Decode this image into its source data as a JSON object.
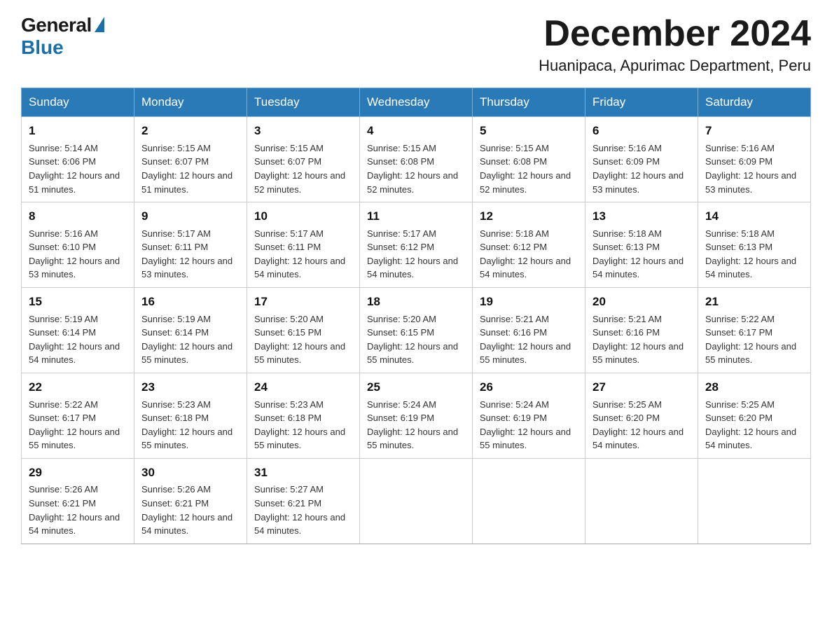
{
  "header": {
    "logo_general": "General",
    "logo_blue": "Blue",
    "month_title": "December 2024",
    "location": "Huanipaca, Apurimac Department, Peru"
  },
  "weekdays": [
    "Sunday",
    "Monday",
    "Tuesday",
    "Wednesday",
    "Thursday",
    "Friday",
    "Saturday"
  ],
  "weeks": [
    [
      {
        "day": "1",
        "sunrise": "5:14 AM",
        "sunset": "6:06 PM",
        "daylight": "12 hours and 51 minutes."
      },
      {
        "day": "2",
        "sunrise": "5:15 AM",
        "sunset": "6:07 PM",
        "daylight": "12 hours and 51 minutes."
      },
      {
        "day": "3",
        "sunrise": "5:15 AM",
        "sunset": "6:07 PM",
        "daylight": "12 hours and 52 minutes."
      },
      {
        "day": "4",
        "sunrise": "5:15 AM",
        "sunset": "6:08 PM",
        "daylight": "12 hours and 52 minutes."
      },
      {
        "day": "5",
        "sunrise": "5:15 AM",
        "sunset": "6:08 PM",
        "daylight": "12 hours and 52 minutes."
      },
      {
        "day": "6",
        "sunrise": "5:16 AM",
        "sunset": "6:09 PM",
        "daylight": "12 hours and 53 minutes."
      },
      {
        "day": "7",
        "sunrise": "5:16 AM",
        "sunset": "6:09 PM",
        "daylight": "12 hours and 53 minutes."
      }
    ],
    [
      {
        "day": "8",
        "sunrise": "5:16 AM",
        "sunset": "6:10 PM",
        "daylight": "12 hours and 53 minutes."
      },
      {
        "day": "9",
        "sunrise": "5:17 AM",
        "sunset": "6:11 PM",
        "daylight": "12 hours and 53 minutes."
      },
      {
        "day": "10",
        "sunrise": "5:17 AM",
        "sunset": "6:11 PM",
        "daylight": "12 hours and 54 minutes."
      },
      {
        "day": "11",
        "sunrise": "5:17 AM",
        "sunset": "6:12 PM",
        "daylight": "12 hours and 54 minutes."
      },
      {
        "day": "12",
        "sunrise": "5:18 AM",
        "sunset": "6:12 PM",
        "daylight": "12 hours and 54 minutes."
      },
      {
        "day": "13",
        "sunrise": "5:18 AM",
        "sunset": "6:13 PM",
        "daylight": "12 hours and 54 minutes."
      },
      {
        "day": "14",
        "sunrise": "5:18 AM",
        "sunset": "6:13 PM",
        "daylight": "12 hours and 54 minutes."
      }
    ],
    [
      {
        "day": "15",
        "sunrise": "5:19 AM",
        "sunset": "6:14 PM",
        "daylight": "12 hours and 54 minutes."
      },
      {
        "day": "16",
        "sunrise": "5:19 AM",
        "sunset": "6:14 PM",
        "daylight": "12 hours and 55 minutes."
      },
      {
        "day": "17",
        "sunrise": "5:20 AM",
        "sunset": "6:15 PM",
        "daylight": "12 hours and 55 minutes."
      },
      {
        "day": "18",
        "sunrise": "5:20 AM",
        "sunset": "6:15 PM",
        "daylight": "12 hours and 55 minutes."
      },
      {
        "day": "19",
        "sunrise": "5:21 AM",
        "sunset": "6:16 PM",
        "daylight": "12 hours and 55 minutes."
      },
      {
        "day": "20",
        "sunrise": "5:21 AM",
        "sunset": "6:16 PM",
        "daylight": "12 hours and 55 minutes."
      },
      {
        "day": "21",
        "sunrise": "5:22 AM",
        "sunset": "6:17 PM",
        "daylight": "12 hours and 55 minutes."
      }
    ],
    [
      {
        "day": "22",
        "sunrise": "5:22 AM",
        "sunset": "6:17 PM",
        "daylight": "12 hours and 55 minutes."
      },
      {
        "day": "23",
        "sunrise": "5:23 AM",
        "sunset": "6:18 PM",
        "daylight": "12 hours and 55 minutes."
      },
      {
        "day": "24",
        "sunrise": "5:23 AM",
        "sunset": "6:18 PM",
        "daylight": "12 hours and 55 minutes."
      },
      {
        "day": "25",
        "sunrise": "5:24 AM",
        "sunset": "6:19 PM",
        "daylight": "12 hours and 55 minutes."
      },
      {
        "day": "26",
        "sunrise": "5:24 AM",
        "sunset": "6:19 PM",
        "daylight": "12 hours and 55 minutes."
      },
      {
        "day": "27",
        "sunrise": "5:25 AM",
        "sunset": "6:20 PM",
        "daylight": "12 hours and 54 minutes."
      },
      {
        "day": "28",
        "sunrise": "5:25 AM",
        "sunset": "6:20 PM",
        "daylight": "12 hours and 54 minutes."
      }
    ],
    [
      {
        "day": "29",
        "sunrise": "5:26 AM",
        "sunset": "6:21 PM",
        "daylight": "12 hours and 54 minutes."
      },
      {
        "day": "30",
        "sunrise": "5:26 AM",
        "sunset": "6:21 PM",
        "daylight": "12 hours and 54 minutes."
      },
      {
        "day": "31",
        "sunrise": "5:27 AM",
        "sunset": "6:21 PM",
        "daylight": "12 hours and 54 minutes."
      },
      null,
      null,
      null,
      null
    ]
  ]
}
